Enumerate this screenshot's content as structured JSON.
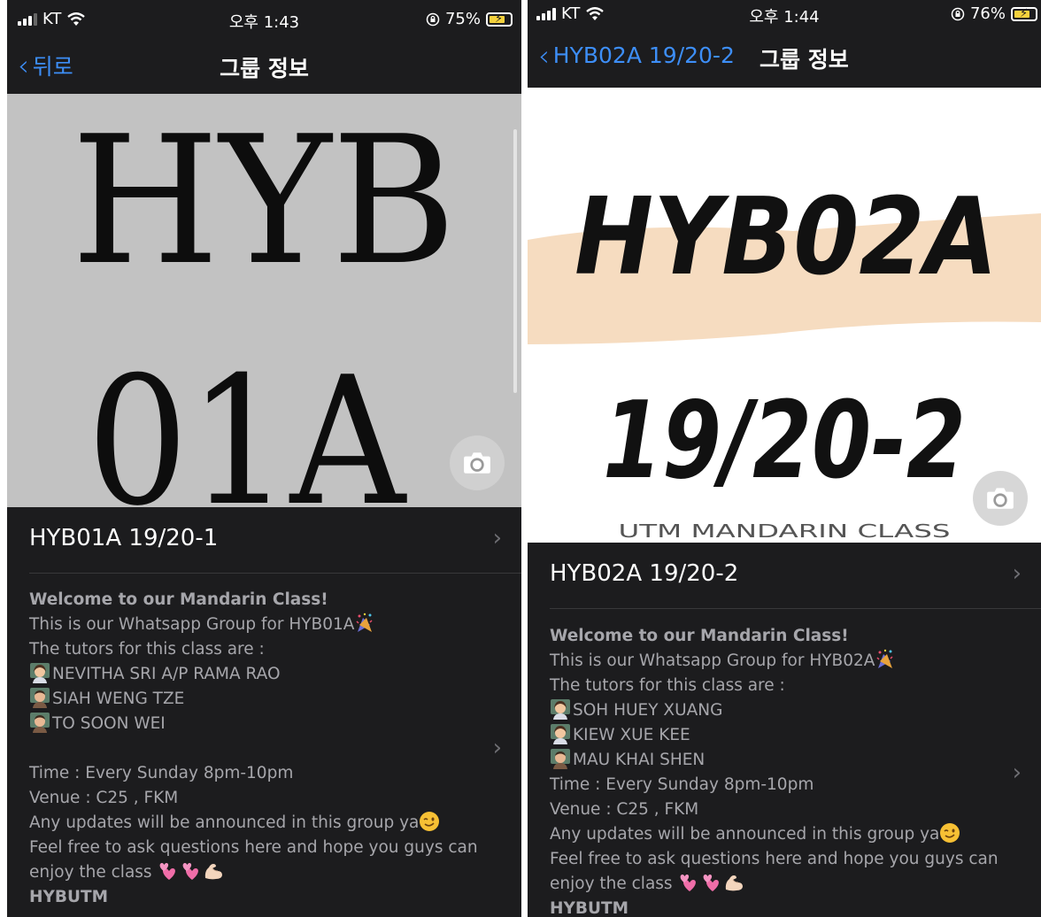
{
  "left": {
    "status": {
      "carrier": "KT",
      "time": "오후 1:43",
      "battery": "75%",
      "battery_level": 0.75
    },
    "nav": {
      "back_label": "뒤로",
      "title": "그룹 정보"
    },
    "photo_text": {
      "line1": "HYB",
      "line2": "01A"
    },
    "group_name": "HYB01A 19/20-1",
    "description": {
      "heading": "Welcome to our Mandarin Class!",
      "intro": "This is our Whatsapp Group for HYB01A",
      "tutors_intro": "The tutors for this class are :",
      "tutors": [
        "NEVITHA SRI A/P RAMA RAO",
        "SIAH WENG TZE",
        "TO SOON WEI"
      ],
      "time": "Time : Every Sunday 8pm-10pm",
      "venue": "Venue : C25 ,  FKM",
      "updates": "Any updates will be announced in this group ya",
      "feel_free": "Feel free to ask questions here and hope you guys can",
      "enjoy": "enjoy the class",
      "signature": "HYBUTM"
    }
  },
  "right": {
    "status": {
      "carrier": "KT",
      "time": "오후 1:44",
      "battery": "76%",
      "battery_level": 0.76
    },
    "nav": {
      "back_label": "HYB02A 19/20-2",
      "title": "그룹 정보"
    },
    "photo_text": {
      "line1": "HYB02A",
      "line2": "19/20-2",
      "line3": "UTM MANDARIN CLASS"
    },
    "group_name": "HYB02A 19/20-2",
    "description": {
      "heading": "Welcome to our Mandarin Class!",
      "intro": "This is our Whatsapp Group for HYB02A",
      "tutors_intro": "The tutors for this class are :",
      "tutors": [
        "SOH HUEY XUANG",
        "KIEW XUE KEE",
        "MAU KHAI SHEN"
      ],
      "time": "Time : Every Sunday 8pm-10pm",
      "venue": "Venue : C25 ,  FKM",
      "updates": "Any updates will be announced in this group ya",
      "feel_free": "Feel free to ask questions here and hope you guys can",
      "enjoy": "enjoy the class",
      "signature": "HYBUTM"
    }
  },
  "colors": {
    "link": "#3d8ef7",
    "background": "#1c1c1e",
    "battery_fill": "#f4d13d"
  }
}
